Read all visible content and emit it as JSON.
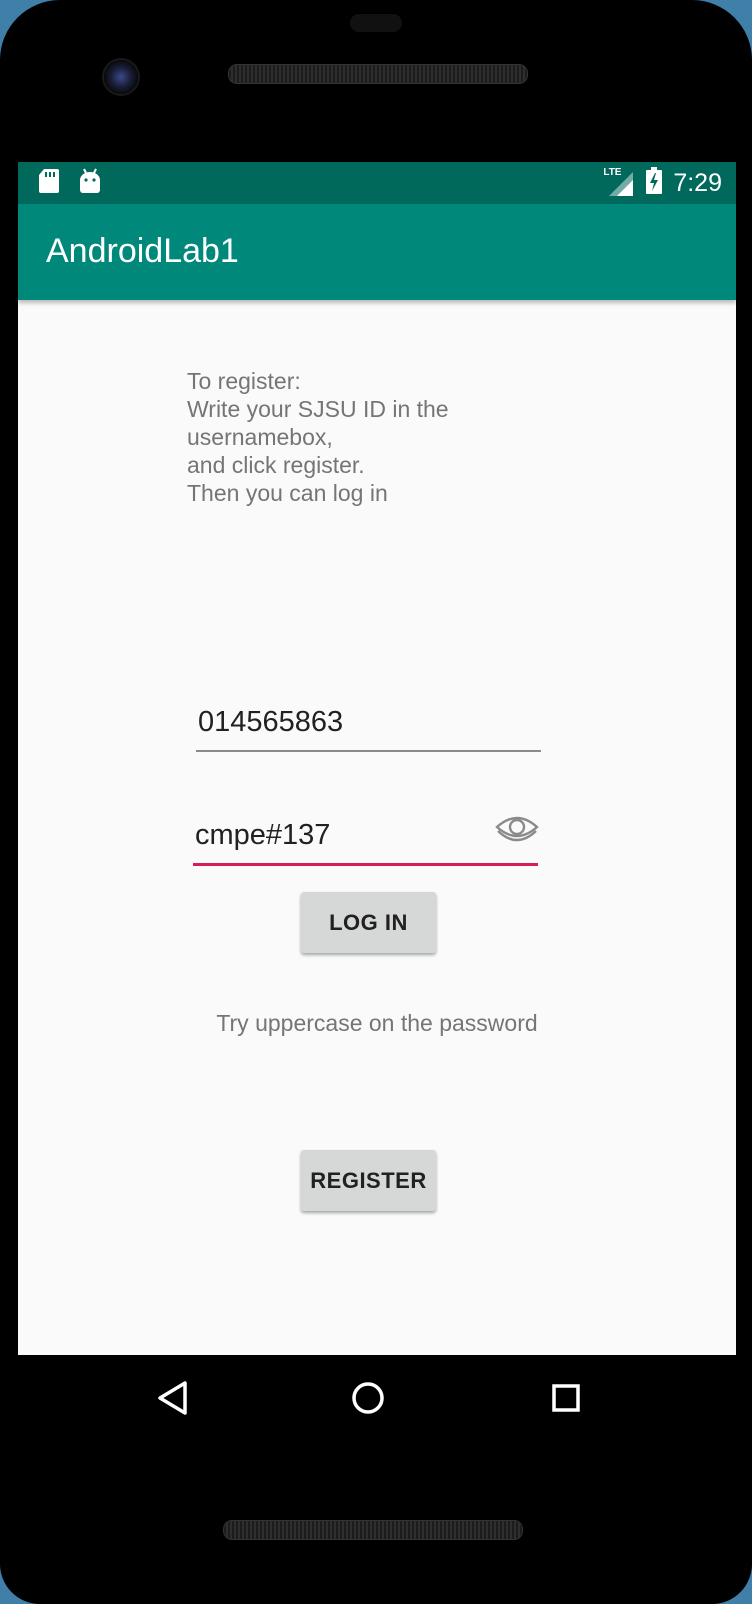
{
  "status_bar": {
    "time": "7:29",
    "network_label": "LTE",
    "icons": [
      "sd-card-icon",
      "android-icon",
      "signal-icon",
      "battery-charging-icon"
    ]
  },
  "app_bar": {
    "title": "AndroidLab1"
  },
  "instructions": {
    "lines": [
      "To register:",
      "Write your SJSU ID in the",
      "usernamebox,",
      "and click register.",
      "Then you can log in"
    ]
  },
  "form": {
    "username_value": "014565863",
    "password_value": "cmpe#137",
    "login_label": "LOG IN",
    "hint_text": "Try uppercase on the password",
    "register_label": "REGISTER"
  },
  "navigation": {
    "buttons": [
      "back-icon",
      "home-icon",
      "recents-icon"
    ]
  },
  "colors": {
    "status_bar": "#00695c",
    "app_bar": "#00897b",
    "accent": "#d81b60",
    "button_bg": "#d6d7d7"
  }
}
